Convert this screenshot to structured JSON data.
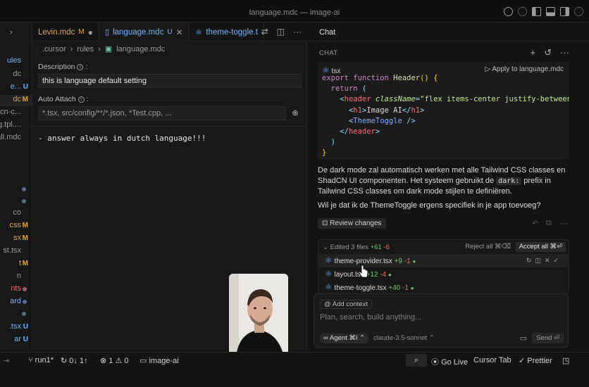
{
  "window": {
    "title": "language.mdc — image-ai"
  },
  "sidebar": {
    "items": [
      {
        "name": "ules",
        "status": "",
        "color": "#6fb3ff"
      },
      {
        "name": "dc",
        "status": "",
        "color": "#9a9a9a"
      },
      {
        "name": "e...",
        "status": "U",
        "color": "#6fb3ff"
      },
      {
        "name": "dc",
        "status": "M",
        "color": "#d8a64c"
      },
      {
        "name": "adcn-c...",
        "status": "",
        "color": "#9a9a9a"
      },
      {
        "name": "log.tpl....",
        "status": "",
        "color": "#9a9a9a"
      },
      {
        "name": "call.mdc",
        "status": "",
        "color": "#9a9a9a"
      },
      {
        "name": "co",
        "status": "",
        "color": "#9a9a9a"
      },
      {
        "name": "css",
        "status": "M",
        "color": "#d8a64c"
      },
      {
        "name": "sx",
        "status": "M",
        "color": "#d8a64c"
      },
      {
        "name": "st.tsx",
        "status": "",
        "color": "#9a9a9a"
      },
      {
        "name": "t",
        "status": "M",
        "color": "#d8a64c"
      },
      {
        "name": "n",
        "status": "",
        "color": "#9a9a9a"
      },
      {
        "name": "nts",
        "status": "",
        "color": "#e06c6c"
      },
      {
        "name": "ard",
        "status": "",
        "color": "#6fb3ff"
      },
      {
        "name": ".tsx",
        "status": "U",
        "color": "#6fb3ff"
      },
      {
        "name": "ar",
        "status": "U",
        "color": "#6fb3ff"
      }
    ]
  },
  "editor": {
    "tabs": [
      {
        "name": "Levin.mdc",
        "status": "M",
        "end": "●"
      },
      {
        "name": "language.mdc",
        "status": "U",
        "end": "✕"
      },
      {
        "name": "theme-toggle.t",
        "status": "",
        "end": ""
      }
    ],
    "breadcrumb": [
      ".cursor",
      "rules",
      "language.mdc"
    ],
    "description_label": "Description",
    "description_value": "this is language default setting",
    "auto_attach_label": "Auto Attach",
    "auto_attach_value": "*.tsx, src/config/**/*.json, *Test.cpp, ...",
    "rule_text": "- answer always in dutch language!!!"
  },
  "chat": {
    "tab_label": "Chat",
    "section_label": "CHAT",
    "code_block": {
      "language": "tsx",
      "apply_label": "Apply to language.mdc"
    },
    "paragraph1_a": "De dark mode zal automatisch werken met alle Tailwind CSS classes en ShadCN UI componenten. Het systeem gebruikt de ",
    "paragraph1_code": "dark:",
    "paragraph1_b": " prefix in Tailwind CSS classes om dark mode stijlen te definiëren.",
    "paragraph2": "Wil je dat ik de ThemeToggle ergens specifiek in je app toevoeg?",
    "review_label": "Review changes",
    "edited": {
      "summary": "Edited 3 files",
      "added": "+61",
      "removed": "-6",
      "reject_label": "Reject all ⌘⌫",
      "accept_label": "Accept all ⌘⏎",
      "files": [
        {
          "name": "theme-provider.tsx",
          "added": "+9",
          "removed": "-1"
        },
        {
          "name": "layout.tsx",
          "added": "+12",
          "removed": "-4"
        },
        {
          "name": "theme-toggle.tsx",
          "added": "+40",
          "removed": "-1"
        }
      ]
    },
    "composer": {
      "add_context": "Add context",
      "placeholder": "Plan, search, build anything...",
      "agent_label": "∞ Agent ⌘I ⌃",
      "model_label": "claude-3.5-sonnet ⌃",
      "send_label": "Send ⏎"
    }
  },
  "statusbar": {
    "branch": "run1*",
    "sync": "0↓ 1↑",
    "errors": "1",
    "warnings": "0",
    "folder": "image-ai",
    "go_live": "Go Live",
    "cursor_tab": "Cursor Tab",
    "prettier": "Prettier"
  },
  "colors": {
    "accent": "#6fb3ff",
    "modified": "#d8a64c",
    "added": "#6fc36f",
    "removed": "#e06c6c"
  }
}
